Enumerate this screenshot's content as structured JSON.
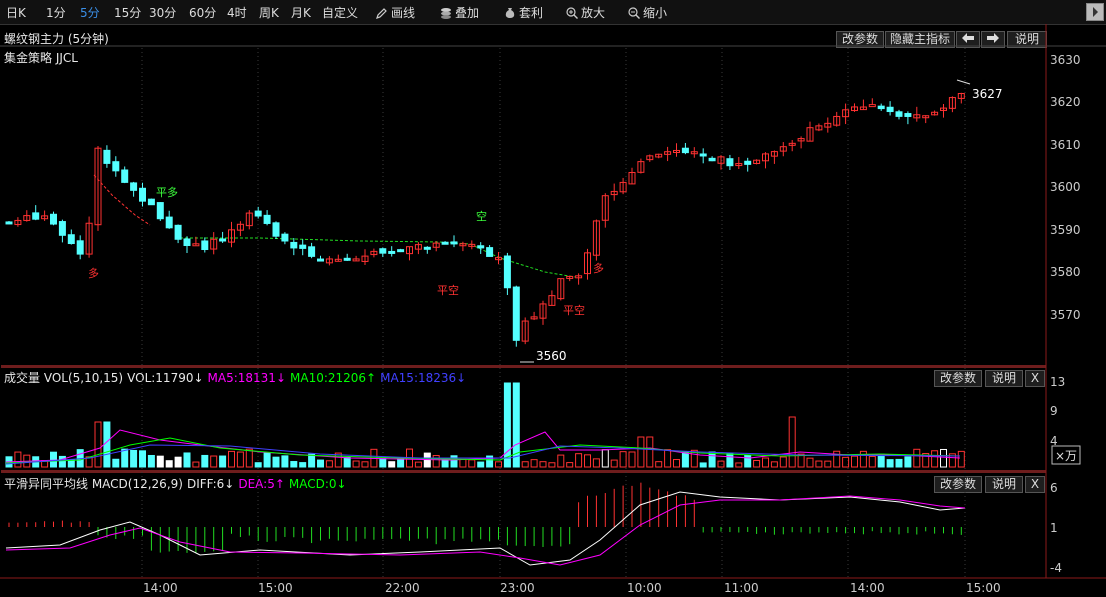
{
  "toolbar": {
    "periods": [
      {
        "label": "日K",
        "active": false
      },
      {
        "label": "1分",
        "active": false
      },
      {
        "label": "5分",
        "active": true
      },
      {
        "label": "15分",
        "active": false
      },
      {
        "label": "30分",
        "active": false
      },
      {
        "label": "60分",
        "active": false
      },
      {
        "label": "4时",
        "active": false
      },
      {
        "label": "周K",
        "active": false
      },
      {
        "label": "月K",
        "active": false
      },
      {
        "label": "自定义",
        "active": false
      }
    ],
    "tools": [
      {
        "label": "画线",
        "icon": "pencil-icon"
      },
      {
        "label": "叠加",
        "icon": "stack-icon"
      },
      {
        "label": "套利",
        "icon": "moneybag-icon"
      },
      {
        "label": "放大",
        "icon": "zoom-in-icon"
      },
      {
        "label": "缩小",
        "icon": "zoom-out-icon"
      }
    ]
  },
  "main": {
    "title": "螺纹钢主力 (5分钟)",
    "strategy": "集金策略 JJCL",
    "buttons": {
      "params": "改参数",
      "hide": "隐藏主指标",
      "explain": "说明"
    },
    "price_labels": [
      "3630",
      "3620",
      "3610",
      "3600",
      "3590",
      "3580",
      "3570"
    ],
    "high_label": "3627",
    "low_label": "3560",
    "signals": [
      {
        "text": "多",
        "type": "long"
      },
      {
        "text": "平多",
        "type": "close-long"
      },
      {
        "text": "空",
        "type": "short"
      },
      {
        "text": "平空",
        "type": "close-short"
      },
      {
        "text": "平空",
        "type": "close-short"
      },
      {
        "text": "多",
        "type": "long"
      }
    ]
  },
  "volume": {
    "title": "成交量 VOL(5,10,15)",
    "vol": "VOL:11790↓",
    "ma5": "MA5:18131↓",
    "ma10": "MA10:21206↑",
    "ma15": "MA15:18236↓",
    "buttons": {
      "params": "改参数",
      "explain": "说明",
      "close": "X"
    },
    "axis_labels": [
      "13",
      "9",
      "4"
    ],
    "unit": "×万"
  },
  "macd": {
    "title": "平滑异同平均线 MACD(12,26,9)",
    "diff": "DIFF:6↓",
    "dea": "DEA:5↑",
    "macd": "MACD:0↓",
    "buttons": {
      "params": "改参数",
      "explain": "说明",
      "close": "X"
    },
    "axis_labels": [
      "6",
      "1",
      "-4"
    ]
  },
  "time_axis": [
    "14:00",
    "15:00",
    "22:00",
    "23:00",
    "10:00",
    "11:00",
    "14:00",
    "15:00"
  ],
  "colors": {
    "up": "#ff3232",
    "down": "#54ffff",
    "white": "#ffffff",
    "ma5": "#ff00ff",
    "ma10": "#00ff00",
    "ma15": "#4040ff",
    "active": "#3a8ee6"
  }
}
